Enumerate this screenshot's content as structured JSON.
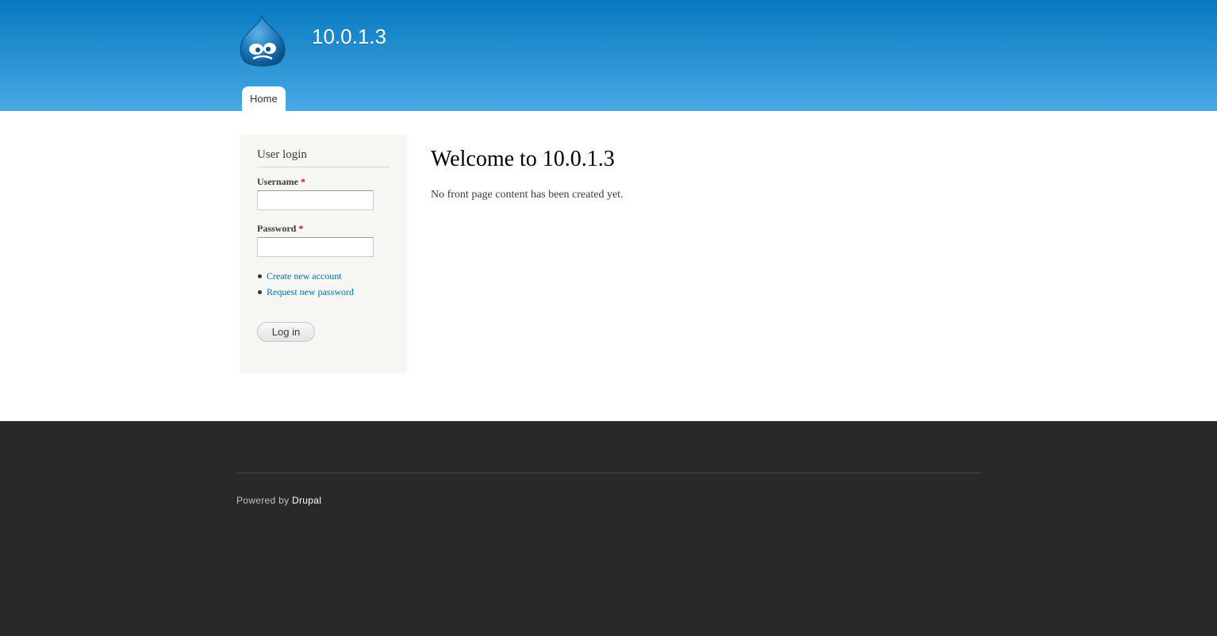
{
  "header": {
    "site_name": "10.0.1.3",
    "logo_icon": "drupal-drop-logo-icon",
    "menu": [
      {
        "label": "Home"
      }
    ]
  },
  "sidebar": {
    "block_title": "User login",
    "username": {
      "label": "Username",
      "required_marker": "*",
      "value": ""
    },
    "password": {
      "label": "Password",
      "required_marker": "*",
      "value": ""
    },
    "links": [
      {
        "label": "Create new account"
      },
      {
        "label": "Request new password"
      }
    ],
    "submit_label": "Log in"
  },
  "main": {
    "title": "Welcome to 10.0.1.3",
    "message": "No front page content has been created yet."
  },
  "footer": {
    "powered_by": "Powered by",
    "link_label": "Drupal"
  },
  "colors": {
    "header_gradient_top": "#0779bf",
    "header_gradient_bottom": "#48a9e4",
    "link": "#0071b3",
    "required": "#ee0000",
    "footer_bg": "#292929",
    "sidebar_bg": "#f6f6f2"
  }
}
